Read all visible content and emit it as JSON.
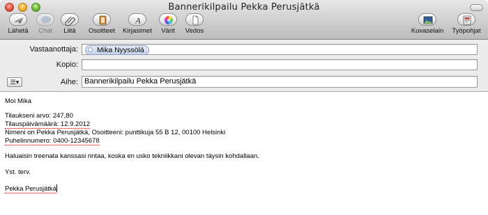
{
  "window": {
    "title": "Bannerikilpailu Pekka Perusjätkä"
  },
  "toolbar": {
    "send": "Lähetä",
    "chat": "Chat",
    "attach": "Liitä",
    "addresses": "Osoitteet",
    "fonts": "Kirjasimet",
    "colors": "Värit",
    "save_draft": "Vedos",
    "photo_browser": "Kuvaselain",
    "templates": "Työpohjat"
  },
  "header": {
    "to_label": "Vastaanottaja:",
    "to_recipient": "Mika Nyyssölä",
    "cc_label": "Kopio:",
    "cc_value": "",
    "subject_label": "Aihe:",
    "subject_value": "Bannerikilpailu Pekka Perusjätkä",
    "header_menu_icon": "list-menu-icon"
  },
  "message": {
    "greeting": "Moi Mika",
    "order_value": "Tilaukseni arvo: 247,80",
    "order_date": "Tilauspäivämäärä: 12.9.2012",
    "name_address": "Nimeni on Pekka Perusjätkä, Osoitteeni: punttikuja 55 B 12, 00100 Helsinki",
    "phone": "Puhelinnumero: 0400-12345678",
    "paragraph": "Haluaisin treenata kanssasi rintaa, koska en usko tekniikkani olevan täysin kohdallaan.",
    "closing": "Yst. terv.",
    "signature": "Pekka Perusjätkä"
  },
  "colors": {
    "title_gradient_top": "#e8e8e8",
    "title_gradient_bottom": "#bcbcbc",
    "header_bg": "#ececec",
    "token_bg": "#c7d2e9",
    "spellcheck": "#dd1111"
  },
  "icons": {
    "send": "paper-plane-icon",
    "chat": "speech-bubble-icon",
    "attach": "paperclip-icon",
    "addresses": "address-book-icon",
    "fonts": "font-icon",
    "colors": "color-wheel-icon",
    "save_draft": "document-icon",
    "photo_browser": "photo-icon",
    "templates": "stationery-icon"
  }
}
